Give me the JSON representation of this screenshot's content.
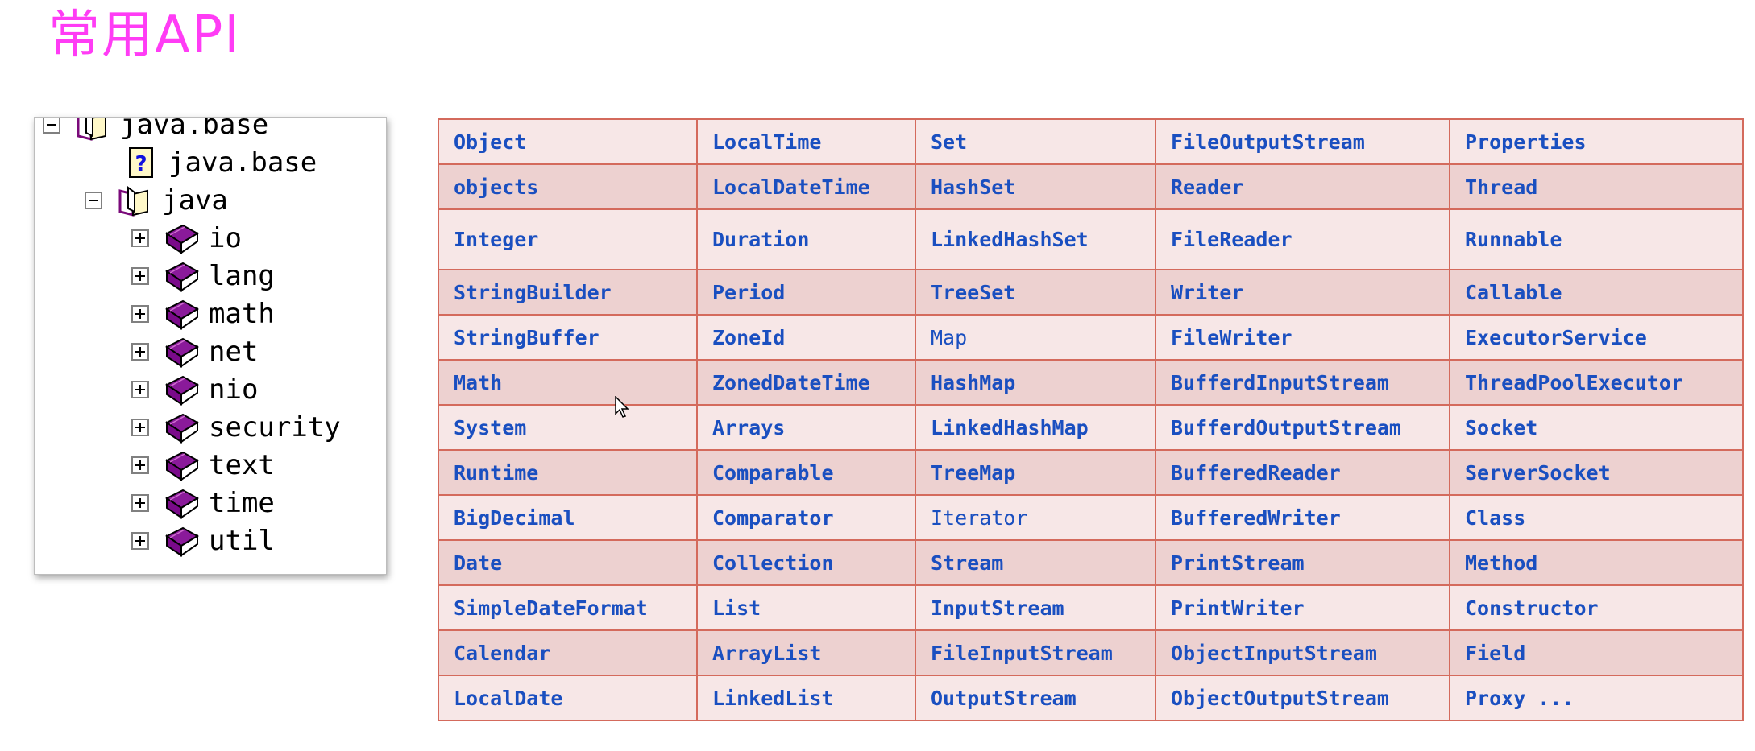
{
  "title": "常用API",
  "tree": {
    "nodes": [
      {
        "label": "java.base",
        "toggle": "minus",
        "icon": "open-book-icon",
        "level": 0
      },
      {
        "label": "java.base",
        "toggle": "none",
        "icon": "help-page-icon",
        "level": 1
      },
      {
        "label": "java",
        "toggle": "minus",
        "icon": "open-book-icon",
        "level": 1
      },
      {
        "label": "io",
        "toggle": "plus",
        "icon": "closed-book-icon",
        "level": 2
      },
      {
        "label": "lang",
        "toggle": "plus",
        "icon": "closed-book-icon",
        "level": 2
      },
      {
        "label": "math",
        "toggle": "plus",
        "icon": "closed-book-icon",
        "level": 2
      },
      {
        "label": "net",
        "toggle": "plus",
        "icon": "closed-book-icon",
        "level": 2
      },
      {
        "label": "nio",
        "toggle": "plus",
        "icon": "closed-book-icon",
        "level": 2
      },
      {
        "label": "security",
        "toggle": "plus",
        "icon": "closed-book-icon",
        "level": 2
      },
      {
        "label": "text",
        "toggle": "plus",
        "icon": "closed-book-icon",
        "level": 2
      },
      {
        "label": "time",
        "toggle": "plus",
        "icon": "closed-book-icon",
        "level": 2
      },
      {
        "label": "util",
        "toggle": "plus",
        "icon": "closed-book-icon",
        "level": 2
      }
    ]
  },
  "table": {
    "rows": [
      [
        "Object",
        "LocalTime",
        "Set",
        "FileOutputStream",
        "Properties"
      ],
      [
        "objects",
        "LocalDateTime",
        "HashSet",
        "Reader",
        "Thread"
      ],
      [
        "Integer",
        "Duration",
        "LinkedHashSet",
        "FileReader",
        "Runnable"
      ],
      [
        "StringBuilder",
        "Period",
        "TreeSet",
        "Writer",
        "Callable"
      ],
      [
        "StringBuffer",
        "ZoneId",
        "Map",
        "FileWriter",
        "ExecutorService"
      ],
      [
        "Math",
        "ZonedDateTime",
        "HashMap",
        "BufferdInputStream",
        "ThreadPoolExecutor"
      ],
      [
        "System",
        "Arrays",
        "LinkedHashMap",
        "BufferdOutputStream",
        "Socket"
      ],
      [
        "Runtime",
        "Comparable",
        "TreeMap",
        "BufferedReader",
        "ServerSocket"
      ],
      [
        "BigDecimal",
        "Comparator",
        "Iterator",
        "BufferedWriter",
        "Class"
      ],
      [
        "Date",
        "Collection",
        "Stream",
        "PrintStream",
        "Method"
      ],
      [
        "SimpleDateFormat",
        "List",
        "InputStream",
        "PrintWriter",
        "Constructor"
      ],
      [
        "Calendar",
        "ArrayList",
        "FileInputStream",
        "ObjectInputStream",
        "Field"
      ],
      [
        "LocalDate",
        "LinkedList",
        "OutputStream",
        "ObjectOutputStream",
        "Proxy ..."
      ]
    ]
  },
  "colors": {
    "title": "#ff3cf5",
    "cell_text": "#1a4fc0",
    "border": "#d46a5c",
    "row_light": "#f7e7e7",
    "row_dark": "#edd1d0"
  }
}
